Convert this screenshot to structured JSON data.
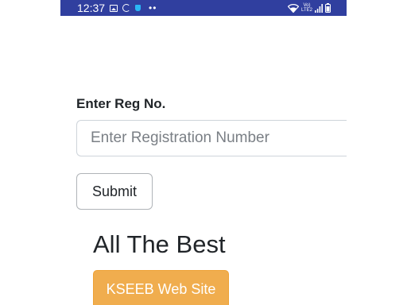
{
  "status_bar": {
    "time": "12:37",
    "volte_line1": "Vo)",
    "volte_line2": "LTE2",
    "colors": {
      "background": "#303f9f",
      "foreground": "#ffffff"
    },
    "icons": [
      "gallery-icon",
      "sync-icon",
      "shop-icon",
      "more-dots-icon",
      "wifi-icon",
      "volte-icon",
      "signal-icon",
      "battery-icon"
    ]
  },
  "form": {
    "label": "Enter Reg No.",
    "input_placeholder": "Enter Registration Number",
    "input_value": "",
    "submit_label": "Submit"
  },
  "content": {
    "heading": "All The Best",
    "link_button_label": "KSEEB Web Site"
  },
  "colors": {
    "accent_button": "#f0ad4e",
    "text": "#212529",
    "input_border": "#ced4da"
  }
}
